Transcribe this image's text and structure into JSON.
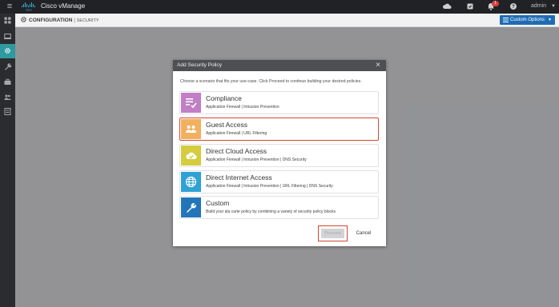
{
  "app": {
    "title": "Cisco vManage",
    "logo_icon": "cisco-logo",
    "user": "admin",
    "notification_count": "1"
  },
  "topbar_icons": [
    "menu-icon",
    "cloud-icon",
    "tasks-icon",
    "bell-icon",
    "help-icon"
  ],
  "sidebar": {
    "items": [
      {
        "name": "dashboard-icon",
        "active": false
      },
      {
        "name": "monitor-icon",
        "active": false
      },
      {
        "name": "configuration-icon",
        "active": true
      },
      {
        "name": "tools-icon",
        "active": false
      },
      {
        "name": "maintenance-icon",
        "active": false
      },
      {
        "name": "administration-icon",
        "active": false
      },
      {
        "name": "analytics-icon",
        "active": false
      }
    ]
  },
  "header": {
    "section": "CONFIGURATION",
    "separator": "|",
    "subsection": "SECURITY",
    "custom_options_label": "Custom Options"
  },
  "modal": {
    "title": "Add Security Policy",
    "close_symbol": "×",
    "instructions": "Choose a scenario that fits your use-case. Click Proceed to continue building your desired policies.",
    "scenarios": [
      {
        "title": "Compliance",
        "description": "Application Firewall | Intrusion Prevention",
        "icon": "compliance-icon",
        "color": "#c17fc5",
        "selected": false
      },
      {
        "title": "Guest Access",
        "description": "Application Firewall | URL Filtering",
        "icon": "guest-access-icon",
        "color": "#f2b05e",
        "selected": true
      },
      {
        "title": "Direct Cloud Access",
        "description": "Application Firewall | Intrusion Prevention | DNS Security",
        "icon": "cloud-check-icon",
        "color": "#d4cc3c",
        "selected": false
      },
      {
        "title": "Direct Internet Access",
        "description": "Application Firewall | Intrusion Prevention | URL Filtering | DNS Security",
        "icon": "globe-icon",
        "color": "#2fa1d6",
        "selected": false
      },
      {
        "title": "Custom",
        "description": "Build your ala carte policy by combining a variety of security policy blocks",
        "icon": "wrench-icon",
        "color": "#2275b9",
        "selected": false
      }
    ],
    "proceed_label": "Proceed",
    "cancel_label": "Cancel"
  },
  "colors": {
    "topbar": "#212225",
    "sidebar": "#2b2c30",
    "sidebar_active": "#2e9aa0",
    "primary_button": "#1f6cb3",
    "highlight": "#d2452d"
  }
}
